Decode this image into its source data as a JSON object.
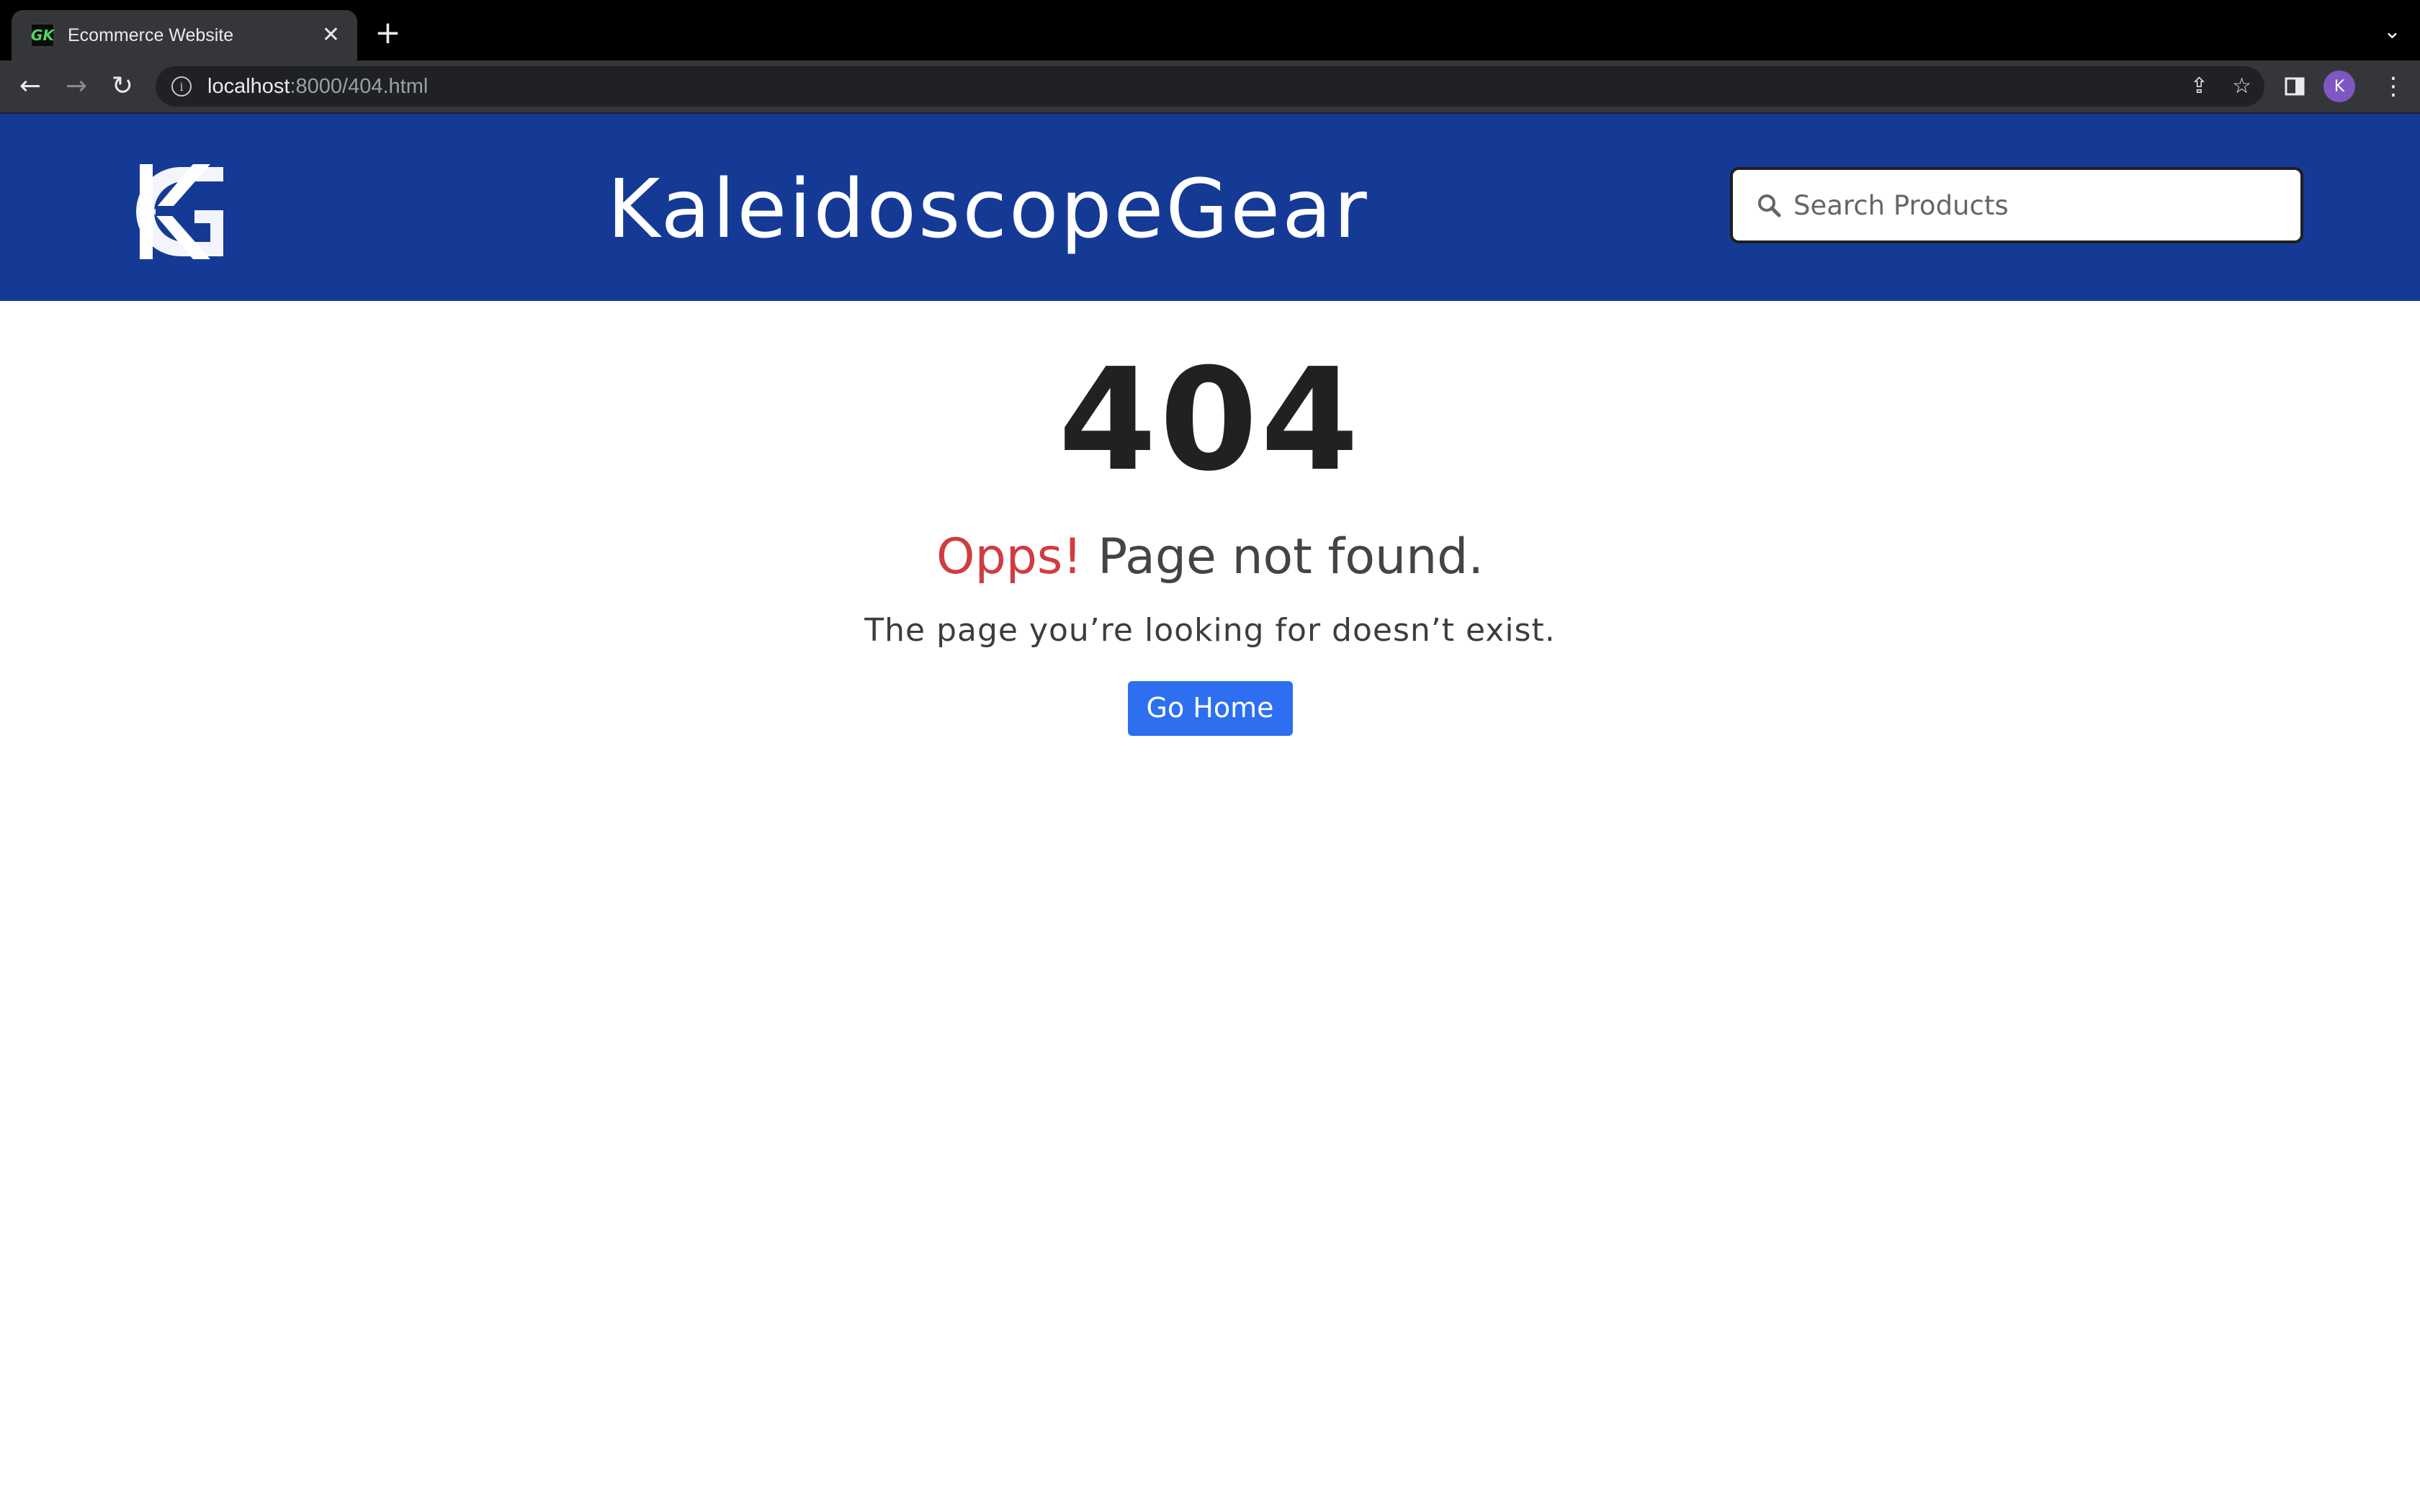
{
  "browser": {
    "tab_title": "Ecommerce Website",
    "favicon_text": "GK",
    "url_host": "localhost",
    "url_rest": ":8000/404.html",
    "profile_initial": "K"
  },
  "header": {
    "brand": "KaleidoscopeGear",
    "logo_text": "KG",
    "search_placeholder": "Search Products",
    "background_color": "#153a96"
  },
  "error": {
    "code": "404",
    "opps": "Opps!",
    "headline": "Page not found.",
    "message": "The page you’re looking for doesn’t exist.",
    "button_label": "Go Home",
    "button_color": "#2d6ff0",
    "opps_color": "#d03c40"
  }
}
